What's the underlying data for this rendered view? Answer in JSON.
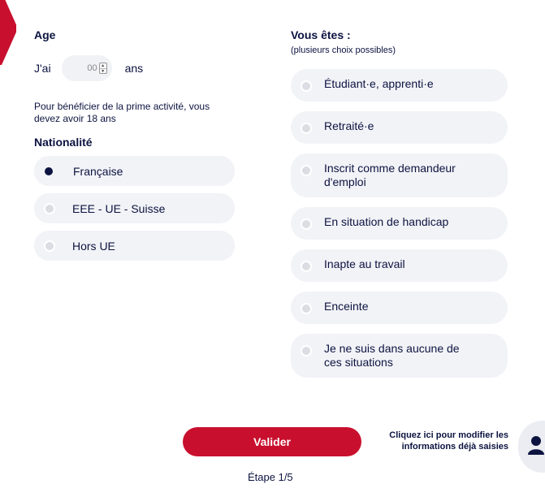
{
  "colors": {
    "brand_red": "#c8102e",
    "navy": "#0c1340",
    "option_bg": "#f2f3f7"
  },
  "age": {
    "title": "Age",
    "prefix": "J'ai",
    "value": "00",
    "suffix": "ans",
    "note": "Pour bénéficier de la prime activité, vous devez avoir 18 ans"
  },
  "nationality": {
    "title": "Nationalité",
    "options": [
      {
        "label": "Française",
        "selected": true
      },
      {
        "label": "EEE - UE - Suisse",
        "selected": false
      },
      {
        "label": "Hors UE",
        "selected": false
      }
    ]
  },
  "situation": {
    "title": "Vous êtes :",
    "subtitle": "(plusieurs choix possibles)",
    "options": [
      {
        "label": "Étudiant·e, apprenti·e"
      },
      {
        "label": "Retraité·e"
      },
      {
        "label": "Inscrit comme demandeur d'emploi"
      },
      {
        "label": "En situation de handicap"
      },
      {
        "label": "Inapte au travail"
      },
      {
        "label": "Enceinte"
      },
      {
        "label": "Je ne suis dans aucune de ces situations"
      }
    ]
  },
  "footer": {
    "validate_label": "Valider",
    "step_label": "Étape 1/5",
    "modify_link": "Cliquez ici pour modifier les informations déjà saisies",
    "avatar_icon": "user-icon"
  }
}
